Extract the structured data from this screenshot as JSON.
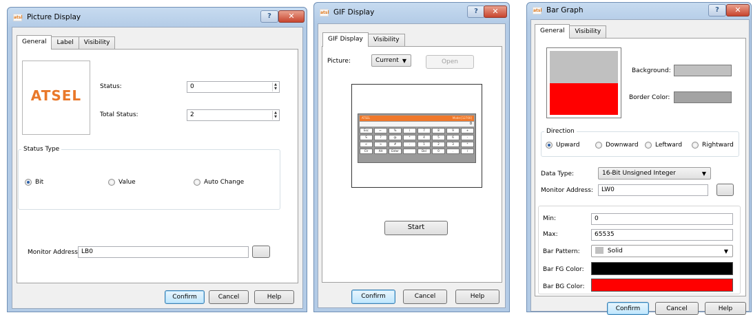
{
  "colors": {
    "title_bg": "#b3cbe6",
    "atsel_orange": "#e9782a",
    "bg_gray": "#c0c0c0",
    "bar_red": "#ff0000",
    "bar_black": "#000000",
    "border_gray": "#a3a3a3"
  },
  "picture_display": {
    "title": "Picture Display",
    "help_glyph": "?",
    "close_glyph": "✕",
    "tabs": [
      "General",
      "Label",
      "Visibility"
    ],
    "logo_text": "ATSEL",
    "status_label": "Status:",
    "status_value": "0",
    "total_status_label": "Total Status:",
    "total_status_value": "2",
    "status_type_title": "Status Type",
    "radio_bit": "Bit",
    "radio_value": "Value",
    "radio_auto": "Auto Change",
    "selected_radio": "Bit",
    "monitor_label": "Monitor Address:",
    "monitor_value": "LB0",
    "confirm": "Confirm",
    "cancel": "Cancel",
    "help": "Help"
  },
  "gif_display": {
    "title": "GIF Display",
    "help_glyph": "?",
    "close_glyph": "✕",
    "tabs": [
      "GIF Display",
      "Visibility"
    ],
    "picture_label": "Picture:",
    "picture_select": "Current",
    "open": "Open",
    "calc_header_left": "ATSEL",
    "calc_header_right": "Mode:[12700]",
    "calc_display": "0",
    "calc_keys": [
      "Esc",
      "←",
      "%",
      "/",
      "7",
      "8",
      "9",
      "+",
      "S",
      "?",
      "@",
      "*",
      "4",
      "5",
      "6",
      "-",
      "<",
      ">",
      "#",
      "-",
      "1",
      "2",
      "3",
      "*",
      "Clr",
      "Alt",
      "Enter",
      "",
      "Del",
      "0",
      ".",
      "/"
    ],
    "start": "Start",
    "confirm": "Confirm",
    "cancel": "Cancel",
    "help": "Help"
  },
  "bar_graph": {
    "title": "Bar Graph",
    "help_glyph": "?",
    "close_glyph": "✕",
    "tabs": [
      "General",
      "Visibility"
    ],
    "background_label": "Background:",
    "border_color_label": "Border Color:",
    "direction_title": "Direction",
    "radio_upward": "Upward",
    "radio_downward": "Downward",
    "radio_leftward": "Leftward",
    "radio_rightward": "Rightward",
    "selected_direction": "Upward",
    "data_type_label": "Data Type:",
    "data_type_value": "16-Bit Unsigned Integer",
    "monitor_label": "Monitor Address:",
    "monitor_value": "LW0",
    "min_label": "Min:",
    "min_value": "0",
    "max_label": "Max:",
    "max_value": "65535",
    "bar_pattern_label": "Bar Pattern:",
    "bar_pattern_value": "Solid",
    "fg_color_label": "Bar FG Color:",
    "bg_color_label": "Bar BG Color:",
    "confirm": "Confirm",
    "cancel": "Cancel",
    "help": "Help"
  }
}
